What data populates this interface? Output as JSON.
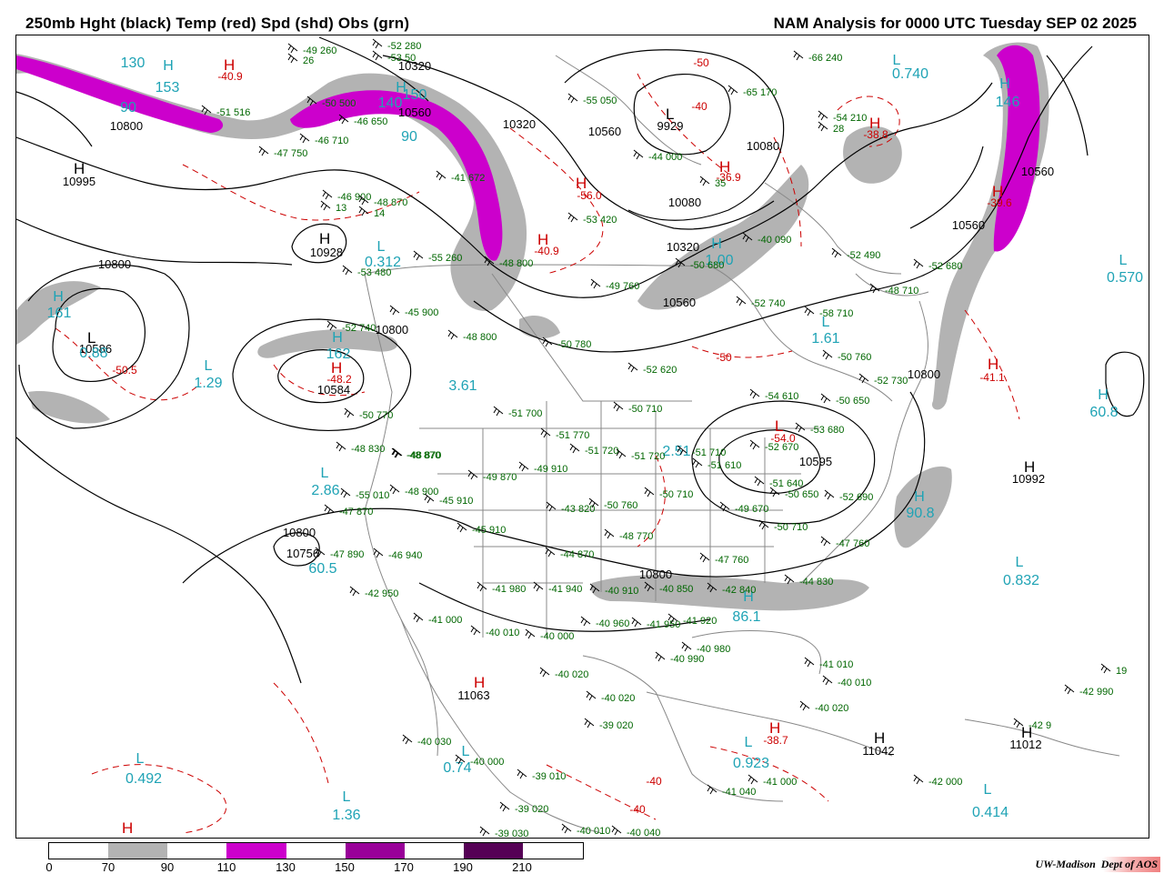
{
  "header": {
    "title_left": "250mb Hght (black) Temp (red) Spd (shd) Obs (grn)",
    "title_right": "NAM Analysis for 0000 UTC Tuesday  SEP 02 2025"
  },
  "colors": {
    "height_contour": "#000000",
    "temp_contour": "#cc0000",
    "station_obs": "#006600",
    "center_label": "#1fa3b5",
    "map_outline": "#888888",
    "speed_70_90": "#b3b3b3",
    "speed_110_130": "#cc00cc",
    "speed_150_170": "#990099",
    "speed_190_210": "#550055"
  },
  "colorbar": {
    "ticks": [
      "0",
      "70",
      "90",
      "110",
      "130",
      "150",
      "170",
      "190",
      "210"
    ],
    "segments": [
      {
        "color": "#ffffff"
      },
      {
        "color": "#b3b3b3"
      },
      {
        "color": "#ffffff"
      },
      {
        "color": "#cc00cc"
      },
      {
        "color": "#ffffff"
      },
      {
        "color": "#990099"
      },
      {
        "color": "#ffffff"
      },
      {
        "color": "#550055"
      },
      {
        "color": "#ffffff"
      }
    ]
  },
  "height_labels": [
    "10800",
    "10995",
    "10320",
    "10560",
    "10560",
    "10320",
    "9929",
    "10080",
    "10080",
    "10928",
    "10800",
    "10586",
    "10800",
    "10584",
    "10800",
    "10560",
    "10595",
    "10992",
    "10560",
    "10800",
    "10756",
    "10800",
    "11063",
    "11042",
    "11012",
    "10320",
    "10560"
  ],
  "temp_labels": [
    "-40.9",
    "-56.0",
    "-40.9",
    "-36.9",
    "-38.8",
    "-39.6",
    "-50.5",
    "-48.2",
    "-41.1",
    "-54.0",
    "-38.7",
    "-50",
    "-50",
    "-40",
    "-40",
    "-40"
  ],
  "speed_labels": [
    "130",
    "153",
    "90",
    "140",
    "150",
    "90",
    "0.740",
    "146",
    "0.312",
    "161",
    "162",
    "0.570",
    "0.88",
    "1.29",
    "3.61",
    "1.61",
    "60.8",
    "2.86",
    "60.5",
    "90.8",
    "0.832",
    "2.51",
    "86.1",
    "0.492",
    "0.74",
    "0.923",
    "1.36",
    "0.414",
    "1.00"
  ],
  "obs": [
    "-49 260",
    "26",
    "-52 280",
    "-53 50",
    "-50 500",
    "-51 516",
    "-46 650",
    "-46 710",
    "-47 750",
    "-46 900",
    "13",
    "-48 870",
    "14",
    "-41 672",
    "-55 050",
    "-65 170",
    "-66 240",
    "-54 210",
    "28",
    "-44 000",
    "35",
    "-40 090",
    "-52 490",
    "-50 680",
    "-52 680",
    "-48 710",
    "-52 740",
    "-58 710",
    "-49 760",
    "-53 420",
    "-55 260",
    "-48 800",
    "-53 480",
    "-45 900",
    "-48 800",
    "-50 780",
    "-52 620",
    "-50 710",
    "-51 700",
    "-51 770",
    "-51 720",
    "-51 720",
    "-51 710",
    "-52 670",
    "-54 610",
    "-53 680",
    "-50 650",
    "-52 730",
    "-50 760",
    "-52 740",
    "-50 770",
    "-48 830",
    "-48 870",
    "-48 870",
    "-49 870",
    "-49 910",
    "-55 010",
    "-48 900",
    "-45 910",
    "-43 820",
    "-50 760",
    "-50 710",
    "-51 610",
    "-51 640",
    "-49 670",
    "-50 650",
    "-52 690",
    "-50 710",
    "-47 760",
    "-47 870",
    "-47 890",
    "-46 940",
    "-45 910",
    "-44 870",
    "-48 770",
    "-47 760",
    "-41 980",
    "-41 940",
    "-40 910",
    "-40 850",
    "-42 840",
    "-44 830",
    "-42 950",
    "-41 000",
    "-40 010",
    "-40 000",
    "-40 960",
    "-41 950",
    "-41 920",
    "-40 980",
    "-40 990",
    "-41 010",
    "-40 010",
    "-40 020",
    "-40 020",
    "-40 020",
    "-39 020",
    "-40 030",
    "-40 000",
    "-39 010",
    "-39 020",
    "-39 030",
    "-40 010",
    "-40 040",
    "-41 040",
    "-41 000",
    "-42 000",
    "-42 990",
    "-42 9",
    "19"
  ]
}
